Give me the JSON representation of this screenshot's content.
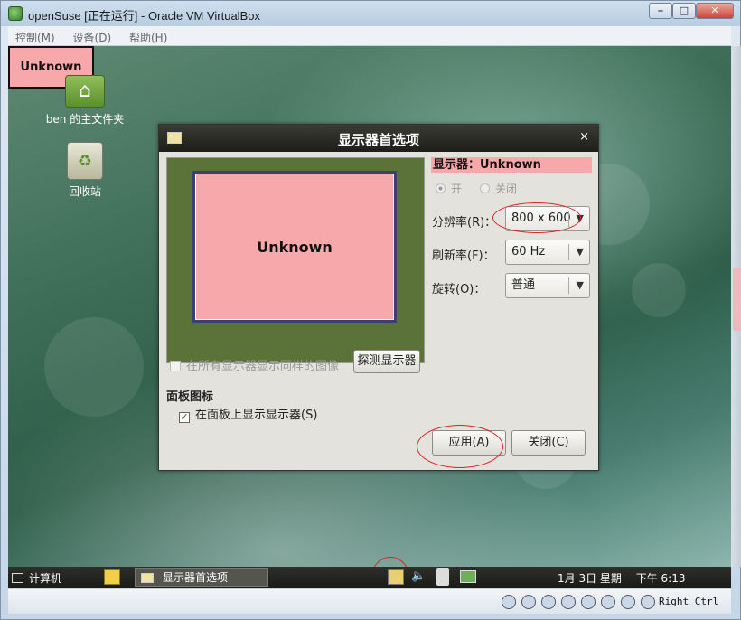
{
  "window": {
    "title": "openSuse [正在运行] - Oracle VM VirtualBox",
    "min_label": "⎯",
    "max_label": "□",
    "close_label": "✕"
  },
  "menubar": {
    "items": [
      "控制(M)",
      "设备(D)",
      "帮助(H)"
    ]
  },
  "desktop": {
    "unknown_label": "Unknown",
    "icons": [
      {
        "label": "ben 的主文件夹",
        "icon": "home-folder-icon"
      },
      {
        "label": "回收站",
        "icon": "trash-icon"
      }
    ]
  },
  "dialog": {
    "title": "显示器首选项",
    "close_glyph": "×",
    "preview_monitor_label": "Unknown",
    "monitor_name": "显示器：Unknown",
    "radio_on": "开",
    "radio_off": "关闭",
    "resolution_label": "分辨率(R)：",
    "resolution_value": "800 x 600",
    "refresh_label": "刷新率(F)：",
    "refresh_value": "60 Hz",
    "rotation_label": "旋转(O)：",
    "rotation_value": "普通",
    "mirror_label": "在所有显示器显示同样的图像",
    "detect_button": "探测显示器",
    "panel_heading": "面板图标",
    "panel_checkbox": "在面板上显示显示器(S)",
    "panel_checked": true,
    "apply_button": "应用(A)",
    "close_button": "关闭(C)"
  },
  "taskbar": {
    "computer_label": "计算机",
    "task_label": "显示器首选项",
    "clock": "1月 3日 星期一  下午  6:13"
  },
  "statusbar": {
    "host_key": "Right Ctrl"
  },
  "colors": {
    "highlight_pink": "#f7a8ab",
    "annotation_red": "#dd2222",
    "dialog_title": "#1d1d19"
  }
}
